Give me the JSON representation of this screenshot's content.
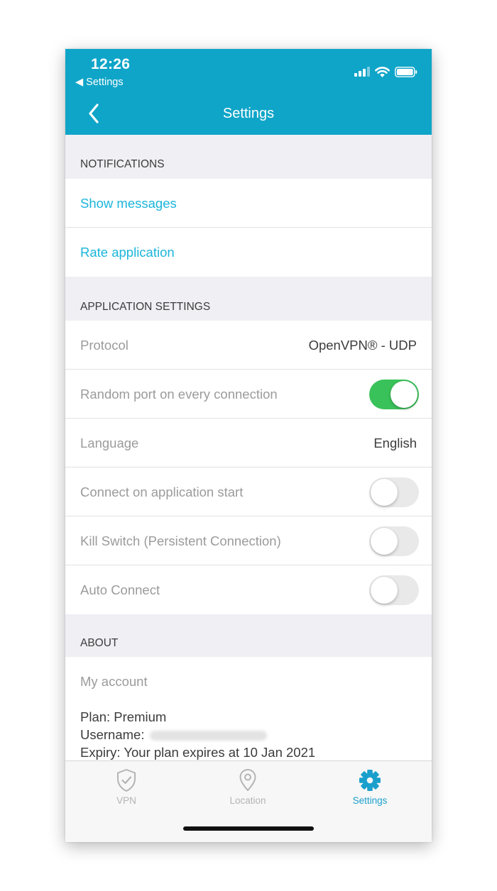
{
  "status_bar": {
    "time": "12:26",
    "back_label": "◀ Settings"
  },
  "nav": {
    "title": "Settings"
  },
  "notifications": {
    "header": "NOTIFICATIONS",
    "show_messages": "Show messages",
    "rate_application": "Rate application"
  },
  "app_settings": {
    "header": "APPLICATION SETTINGS",
    "protocol": {
      "label": "Protocol",
      "value": "OpenVPN® - UDP"
    },
    "random_port": {
      "label": "Random port on every connection",
      "enabled": true
    },
    "language": {
      "label": "Language",
      "value": "English"
    },
    "connect_on_start": {
      "label": "Connect on application start",
      "enabled": false
    },
    "kill_switch": {
      "label": "Kill Switch (Persistent Connection)",
      "enabled": false
    },
    "auto_connect": {
      "label": "Auto Connect",
      "enabled": false
    }
  },
  "about": {
    "header": "ABOUT",
    "my_account": "My account",
    "plan": "Plan: Premium",
    "username_label": "Username:",
    "expiry": "Expiry: Your plan expires at 10 Jan 2021"
  },
  "tabbar": {
    "tabs": [
      {
        "label": "VPN",
        "icon": "shield-check-icon",
        "active": false
      },
      {
        "label": "Location",
        "icon": "location-pin-icon",
        "active": false
      },
      {
        "label": "Settings",
        "icon": "gear-icon",
        "active": true
      }
    ]
  },
  "colors": {
    "header_bg": "#0fa5c8",
    "link": "#1bb5db",
    "toggle_on": "#3ac25a",
    "tab_active": "#1a9fcc",
    "tab_inactive": "#b4b4b4"
  }
}
